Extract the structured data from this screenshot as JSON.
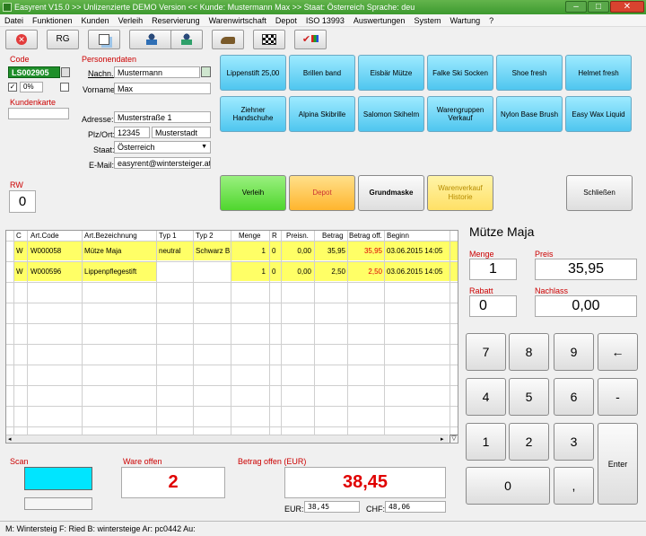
{
  "window": {
    "title": "Easyrent V15.0 >> Unlizenzierte DEMO Version <<    Kunde: Mustermann Max    >> Staat: Österreich Sprache: deu",
    "controls": [
      "–",
      "□",
      "✕"
    ]
  },
  "menu": [
    "Datei",
    "Funktionen",
    "Kunden",
    "Verleih",
    "Reservierung",
    "Warenwirtschaft",
    "Depot",
    "ISO 13993",
    "Auswertungen",
    "System",
    "Wartung",
    "?"
  ],
  "toolbar": {
    "rg_label": "RG"
  },
  "code": {
    "heading": "Code",
    "value": "LS002905",
    "percent": "0%",
    "kundenkarte_label": "Kundenkarte",
    "kundenkarte_value": ""
  },
  "person": {
    "heading": "Personendaten",
    "nachname_label": "Nachn.:",
    "nachname": "Mustermann",
    "vorname_label": "Vorname:",
    "vorname": "Max",
    "adresse_label": "Adresse:",
    "adresse": "Musterstraße 1",
    "plz_label": "Plz/Ort:",
    "plz": "12345",
    "ort": "Musterstadt",
    "staat_label": "Staat:",
    "staat": "Österreich",
    "email_label": "E-Mail:",
    "email": "easyrent@wintersteiger.at"
  },
  "tiles": [
    "Lippenstift 25,00",
    "Brillen band",
    "Eisbär Mütze",
    "Falke Ski Socken",
    "Shoe fresh",
    "Helmet fresh",
    "Ziehner Handschuhe",
    "Alpina Skibrille",
    "Salomon Skihelm",
    "Warengruppen Verkauf",
    "Nylon Base Brush",
    "Easy Wax Liquid"
  ],
  "actions": {
    "verleih": "Verleih",
    "depot": "Depot",
    "grundmaske": "Grundmaske",
    "warenverkauf": "Warenverkauf Historie",
    "schliessen": "Schließen"
  },
  "rw": {
    "label": "RW",
    "value": "0"
  },
  "table": {
    "columns": [
      "C",
      "Art.Code",
      "Art.Bezeichnung",
      "Typ 1",
      "Typ 2",
      "Menge",
      "R",
      "Preisn.",
      "Betrag",
      "Betrag off.",
      "Beginn"
    ],
    "rows": [
      [
        "W",
        "W000058",
        "Mütze Maja",
        "neutral",
        "Schwarz B",
        "1",
        "0",
        "0,00",
        "35,95",
        "35,95",
        "03.06.2015  14:05"
      ],
      [
        "W",
        "W000596",
        "Lippenpflegestift",
        "",
        "",
        "1",
        "0",
        "0,00",
        "2,50",
        "2,50",
        "03.06.2015  14:05"
      ]
    ]
  },
  "detail": {
    "title": "Mütze Maja",
    "menge_label": "Menge",
    "menge": "1",
    "preis_label": "Preis",
    "preis": "35,95",
    "rabatt_label": "Rabatt",
    "rabatt": "0",
    "nachlass_label": "Nachlass",
    "nachlass": "0,00"
  },
  "keypad": {
    "k7": "7",
    "k8": "8",
    "k9": "9",
    "back": "←",
    "k4": "4",
    "k5": "5",
    "k6": "6",
    "minus": "-",
    "k1": "1",
    "k2": "2",
    "k3": "3",
    "enter": "Enter",
    "k0": "0",
    "comma": ","
  },
  "footer": {
    "scan_label": "Scan",
    "ware_offen_label": "Ware offen",
    "ware_offen": "2",
    "betrag_label": "Betrag offen (EUR)",
    "betrag": "38,45",
    "eur_label": "EUR:",
    "eur": "38,45",
    "chf_label": "CHF:",
    "chf": "48,06"
  },
  "statusbar": "M: Wintersteig F: Ried B: wintersteige Ar: pc0442 Au:",
  "colors": {
    "titlebar": "#4aa63a",
    "tile": "#5ccdf2",
    "verleih": "#66e24a",
    "depot": "#ffc34d",
    "highlight_row": "#ffff66",
    "red_text": "#e00000",
    "scan_field": "#00e5ff"
  }
}
